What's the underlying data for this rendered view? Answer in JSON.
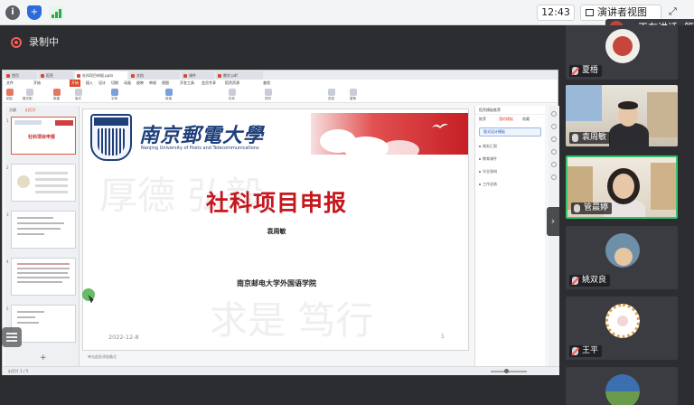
{
  "topbar": {
    "clock": "12:43",
    "present_label": "演讲者视图",
    "expand_icon": "⤢"
  },
  "recording": {
    "label": "录制中"
  },
  "speaking": {
    "label": "正在讲话: 管"
  },
  "ppt": {
    "tabs": [
      "首页",
      "稻壳",
      "社科项目申报.pptx",
      "文档",
      "课件",
      "教学 pdf"
    ],
    "menus": [
      "文件",
      "开始",
      "插入",
      "设计",
      "切换",
      "动画",
      "放映",
      "审阅",
      "视图",
      "开发工具",
      "会员专享",
      "稻壳资源",
      "查找"
    ],
    "active_menu": "开始",
    "ribbon_labels": [
      "粘贴",
      "格式刷",
      "新建",
      "版式",
      "字体",
      "段落",
      "形状",
      "排列",
      "查找",
      "替换"
    ],
    "thumb_tabs": [
      "大纲",
      "幻灯片"
    ],
    "thumb_title": "社科项目申报",
    "slide": {
      "uni_cn": "南京郵電大學",
      "uni_en": "Nanjing University of Posts and Telecommunications",
      "watermark_1": "厚德 弘毅",
      "watermark_2": "求是 笃行",
      "title": "社科项目申报",
      "presenter": "袁周敏",
      "school": "南京邮电大学外国语学院",
      "date": "2022-12-8",
      "page": "1"
    },
    "notes_placeholder": "单击此处添加备注",
    "taskpane": {
      "header": "稻壳模板推荐",
      "tabs": [
        "推荐",
        "我的模板",
        "收藏"
      ],
      "selected": "版式设计模板",
      "items": [
        "商务汇报",
        "教育课件",
        "毕业答辩",
        "工作总结"
      ]
    },
    "status": "幻灯片 1 / 5"
  },
  "participants": [
    {
      "name": "夏梧",
      "muted": true
    },
    {
      "name": "袁周敏",
      "muted": false
    },
    {
      "name": "管晨婷",
      "muted": false
    },
    {
      "name": "姚双良",
      "muted": true
    },
    {
      "name": "王平",
      "muted": true
    }
  ]
}
